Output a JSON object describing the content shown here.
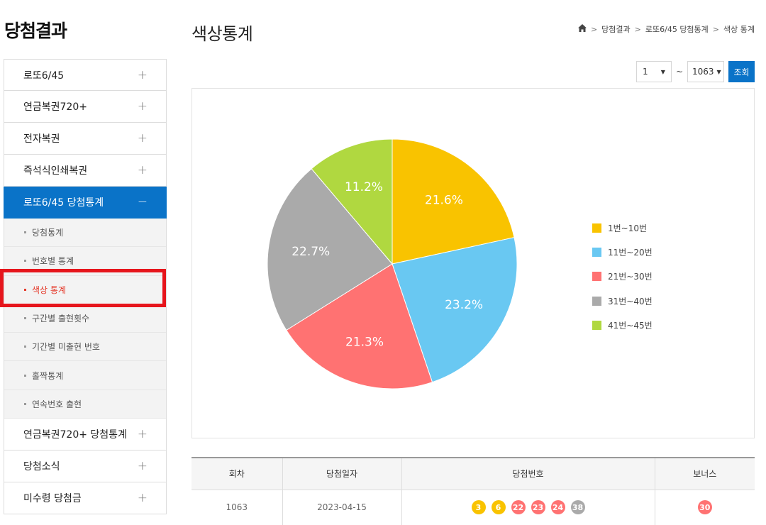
{
  "sidebar": {
    "title": "당첨결과",
    "menu_top": [
      {
        "label": "로또6/45",
        "icon": "plus-icon",
        "sign": "+"
      },
      {
        "label": "연금복권720+",
        "icon": "plus-icon",
        "sign": "+"
      },
      {
        "label": "전자복권",
        "icon": "plus-icon",
        "sign": "+"
      },
      {
        "label": "즉석식인쇄복권",
        "icon": "plus-icon",
        "sign": "+"
      }
    ],
    "active_menu": {
      "label": "로또6/45 당첨통계",
      "icon": "minus-icon",
      "sign": "−"
    },
    "sub_items": [
      {
        "label": "당첨통계"
      },
      {
        "label": "번호별 통계"
      },
      {
        "label": "색상 통계",
        "current": true
      },
      {
        "label": "구간별 출현횟수"
      },
      {
        "label": "기간별 미출현 번호"
      },
      {
        "label": "홀짝통계"
      },
      {
        "label": "연속번호 출현"
      }
    ],
    "menu_bottom": [
      {
        "label": "연금복권720+ 당첨통계",
        "icon": "plus-icon",
        "sign": "+"
      },
      {
        "label": "당첨소식",
        "icon": "plus-icon",
        "sign": "+"
      },
      {
        "label": "미수령 당첨금",
        "icon": "plus-icon",
        "sign": "+"
      }
    ]
  },
  "header": {
    "title": "색상통계",
    "breadcrumb": [
      "당첨결과",
      "로또6/45 당첨통계",
      "색상 통계"
    ],
    "home_icon": "home-icon"
  },
  "range": {
    "from": "1",
    "to": "1063",
    "separator": "~",
    "search_label": "조회"
  },
  "chart_data": {
    "type": "pie",
    "title": "",
    "categories": [
      "1번~10번",
      "11번~20번",
      "21번~30번",
      "31번~40번",
      "41번~45번"
    ],
    "values": [
      21.6,
      23.2,
      21.3,
      22.7,
      11.2
    ],
    "labels": [
      "21.6%",
      "23.2%",
      "21.3%",
      "22.7%",
      "11.2%"
    ],
    "colors": [
      "#f9c300",
      "#69c8f2",
      "#ff7272",
      "#aaaaaa",
      "#b0d840"
    ],
    "legend_position": "right"
  },
  "table": {
    "headers": [
      "회차",
      "당첨일자",
      "당첨번호",
      "보너스"
    ],
    "rows": [
      {
        "round": "1063",
        "date": "2023-04-15",
        "numbers": [
          {
            "n": "3",
            "color": "#f9c300"
          },
          {
            "n": "6",
            "color": "#f9c300"
          },
          {
            "n": "22",
            "color": "#ff7272"
          },
          {
            "n": "23",
            "color": "#ff7272"
          },
          {
            "n": "24",
            "color": "#ff7272"
          },
          {
            "n": "38",
            "color": "#aaaaaa"
          }
        ],
        "bonus": {
          "n": "30",
          "color": "#ff7272"
        }
      }
    ]
  }
}
